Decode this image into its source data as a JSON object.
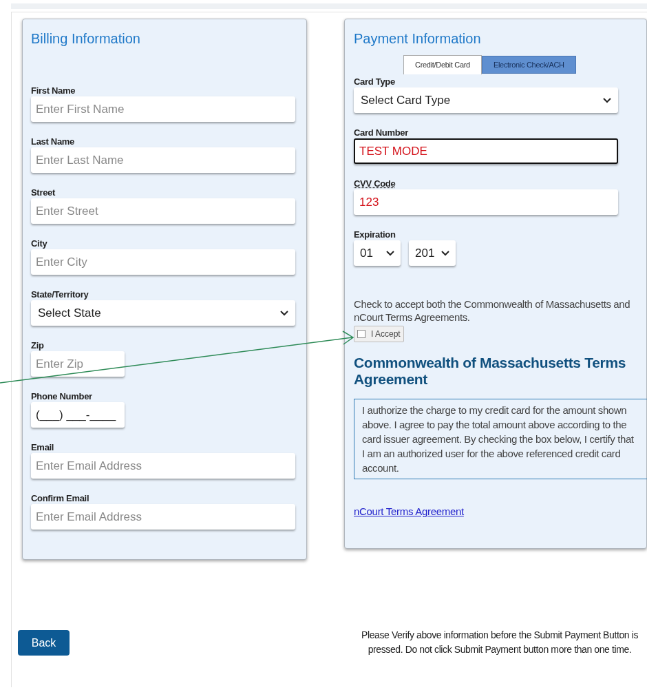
{
  "billing": {
    "title": "Billing Information",
    "fields": [
      {
        "label": "First Name",
        "kind": "text",
        "placeholder": "Enter First Name"
      },
      {
        "label": "Last Name",
        "kind": "text",
        "placeholder": "Enter Last Name"
      },
      {
        "label": "Street",
        "kind": "text",
        "placeholder": "Enter Street"
      },
      {
        "label": "City",
        "kind": "text",
        "placeholder": "Enter City"
      },
      {
        "label": "State/Territory",
        "kind": "select",
        "value": "Select State"
      },
      {
        "label": "Zip",
        "kind": "short",
        "placeholder": "Enter Zip"
      },
      {
        "label": "Phone Number",
        "kind": "short",
        "value": "(___) ___-____"
      },
      {
        "label": "Email",
        "kind": "text",
        "placeholder": "Enter Email Address"
      },
      {
        "label": "Confirm Email",
        "kind": "text",
        "placeholder": "Enter Email Address"
      }
    ]
  },
  "payment": {
    "title": "Payment Information",
    "tabs": [
      {
        "label": "Credit/Debit Card",
        "selected": true
      },
      {
        "label": "Electronic Check/ACH",
        "selected": false
      }
    ],
    "fields": [
      {
        "label": "Card Type",
        "kind": "select",
        "value": "Select Card Type"
      },
      {
        "label": "Card Number",
        "kind": "text",
        "value": "TEST MODE",
        "focused": true
      },
      {
        "label": "CVV Code",
        "kind": "text",
        "value": "123",
        "focused": false
      }
    ],
    "expiration": {
      "label": "Expiration",
      "month": "01",
      "year": "201"
    },
    "consent_text": "Check to accept both the Commonwealth of Massachusetts and nCourt Terms Agreements.",
    "accept": {
      "label": "I Accept",
      "checked": false
    },
    "terms_title": "Commonwealth of Massachusetts Terms Agreement",
    "terms_text": "I authorize the charge to my credit card for the amount shown above. I agree to pay the total amount above according to the card issuer agreement. By checking the box below, I certify that I am an authorized user for the above referenced credit card account.",
    "terms_link": "nCourt Terms Agreement"
  },
  "footer": {
    "back": "Back",
    "notice": "Please Verify above information before the Submit Payment Button is pressed. Do not click Submit Payment button more than one time."
  }
}
